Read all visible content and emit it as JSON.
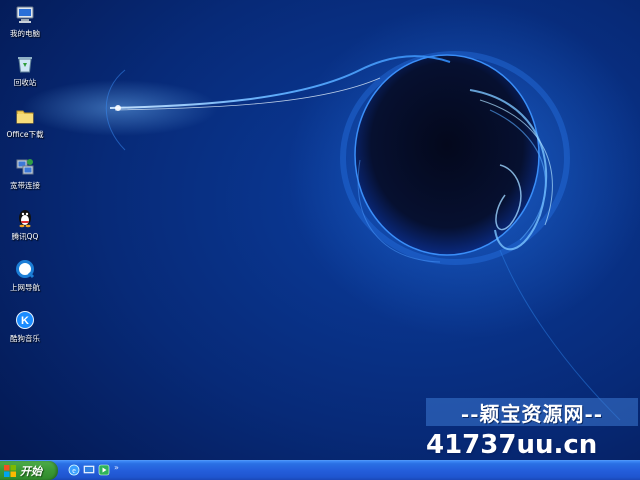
{
  "desktop": {
    "icons": [
      {
        "label": "我的电脑",
        "icon": "my-computer-icon"
      },
      {
        "label": "回收站",
        "icon": "recycle-bin-icon"
      },
      {
        "label": "Office下载",
        "icon": "folder-icon"
      },
      {
        "label": "宽带连接",
        "icon": "broadband-connection-icon"
      },
      {
        "label": "腾讯QQ",
        "icon": "qq-penguin-icon"
      },
      {
        "label": "上网导航",
        "icon": "browser-navigation-icon"
      },
      {
        "label": "酷狗音乐",
        "icon": "kugou-music-icon"
      }
    ]
  },
  "taskbar": {
    "start_label": "开始",
    "quick_launch": [
      "ie-browser-icon",
      "show-desktop-icon",
      "media-player-icon"
    ],
    "chevron": "»"
  },
  "watermark": {
    "top_text": "--颖宝资源网--",
    "bottom_text": "41737uu.cn"
  },
  "colors": {
    "wallpaper": "#072a78",
    "taskbar": "#245edb",
    "start_button": "#3c9a38"
  }
}
